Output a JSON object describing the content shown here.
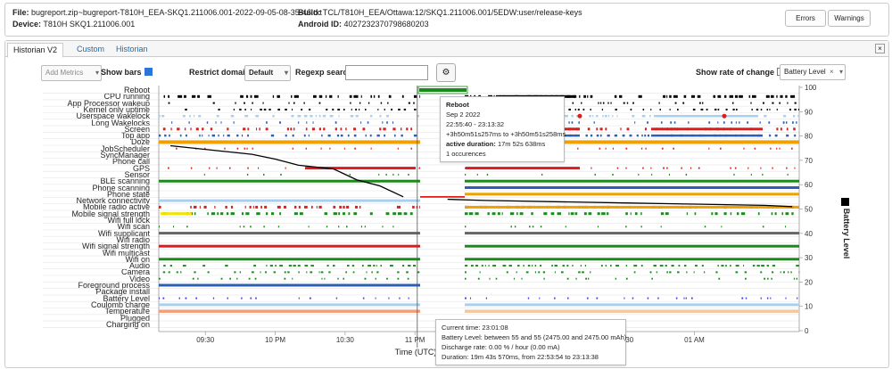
{
  "header": {
    "file_label": "File:",
    "file_value": "bugreport.zip~bugreport-T810H_EEA-SKQ1.211006.001-2022-09-05-08-35-46.txt",
    "device_label": "Device:",
    "device_value": "T810H SKQ1.211006.001",
    "build_label": "Build:",
    "build_value": "TCL/T810H_EEA/Ottawa:12/SKQ1.211006.001/5EDW:user/release-keys",
    "android_id_label": "Android ID:",
    "android_id_value": "4027232370798680203",
    "errors_button": "Errors",
    "warnings_button": "Warnings"
  },
  "tabs": [
    {
      "label": "Historian V2"
    },
    {
      "label": "Custom"
    },
    {
      "label": "Historian"
    }
  ],
  "close_symbol": "×",
  "controls": {
    "add_metrics": "Add Metrics",
    "show_bars": "Show bars",
    "show_bars_checked": true,
    "restrict_domain": "Restrict domain",
    "domain_value": "Default",
    "regexp_search": "Regexp search",
    "regexp_value": "",
    "show_rate": "Show rate of change",
    "show_rate_checked": false,
    "metric_selected": "Battery Level",
    "metric_remove": "×"
  },
  "rows": [
    "Reboot",
    "CPU running",
    "App Processor wakeup",
    "Kernel only uptime",
    "Userspace wakelock",
    "Long Wakelocks",
    "Screen",
    "Top app",
    "Doze",
    "JobScheduler",
    "SyncManager",
    "Phone call",
    "GPS",
    "Sensor",
    "BLE scanning",
    "Phone scanning",
    "Phone state",
    "Network connectivity",
    "Mobile radio active",
    "Mobile signal strength",
    "Wifi full lock",
    "Wifi scan",
    "Wifi supplicant",
    "Wifi radio",
    "Wifi signal strength",
    "Wifi multicast",
    "Wifi on",
    "Audio",
    "Camera",
    "Video",
    "Foreground process",
    "Package install",
    "Battery Level",
    "Coulomb charge",
    "Temperature",
    "Plugged",
    "Charging on"
  ],
  "x_axis": {
    "ticks": [
      "09:30",
      "10 PM",
      "10:30",
      "11 PM",
      "12:30",
      "01 AM"
    ],
    "label": "Time (UTC)"
  },
  "y_axis_right": {
    "ticks": [
      "100",
      "90",
      "80",
      "70",
      "60",
      "50",
      "40",
      "30",
      "20",
      "10",
      "0"
    ],
    "label": "Battery Level",
    "legend_color": "#000000"
  },
  "chart_data": {
    "type": "line",
    "series": [
      {
        "name": "Battery Level",
        "x": [
          "21:15",
          "21:35",
          "21:50",
          "22:00",
          "22:10",
          "22:25",
          "22:35",
          "22:45",
          "22:55",
          "23:14",
          "23:30",
          "00:00",
          "00:30",
          "01:00",
          "01:30",
          "01:42"
        ],
        "values": [
          76,
          74,
          72.5,
          70.5,
          68,
          66.5,
          62,
          59.5,
          55,
          54,
          53.5,
          53,
          52.5,
          52,
          51.5,
          51
        ]
      }
    ],
    "ylim": [
      0,
      100
    ],
    "ylabel": "Battery Level",
    "xlabel": "Time (UTC)"
  },
  "tooltip_reboot": {
    "title": "Reboot",
    "date": "Sep 2 2022",
    "range": "22:55:40 - 23:13:32",
    "offset": "+3h50m51s257ms to +3h50m51s258ms",
    "active_label": "active duration:",
    "active_value": "17m 52s 638ms",
    "occurrences": "1 occurences"
  },
  "tooltip_cursor": {
    "current_time": "Current time: 23:01:08",
    "battery_level": "Battery Level: between 55 and 55 (2475.00 and 2475.00 mAh)",
    "discharge": "Discharge rate: 0.00 % / hour (0.00 mA)",
    "duration": "Duration: 19m 43s 570ms, from 22:53:54 to 23:13:38"
  },
  "colors": {
    "link": "#1f6ab1",
    "red": "#e01b1b",
    "green": "#1a8a1a",
    "orange": "#f0a000",
    "light_blue": "#a8d0ee",
    "blue": "#2c5fb3"
  }
}
